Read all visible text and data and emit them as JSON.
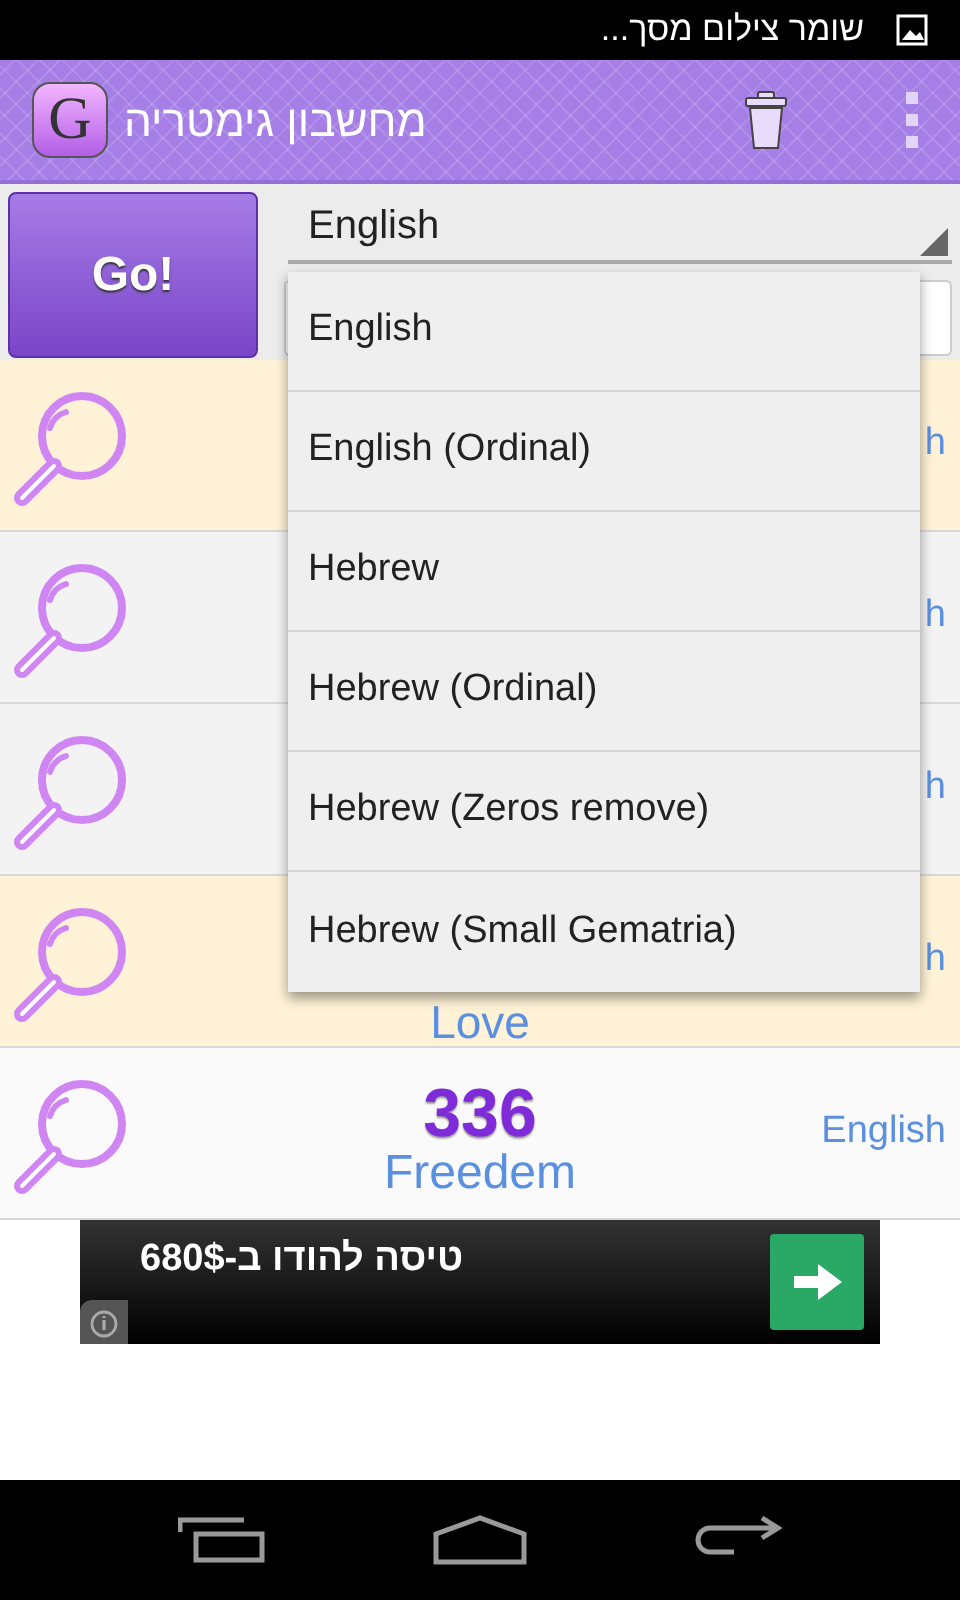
{
  "status_bar": {
    "notification": "שומר צילום מסך..."
  },
  "app_bar": {
    "title": "מחשבון גימטריה",
    "logo_letter": "G"
  },
  "go_button": "Go!",
  "spinner": {
    "value": "English"
  },
  "dropdown": [
    {
      "label": "English",
      "selected": false
    },
    {
      "label": "English (Ordinal)",
      "selected": false
    },
    {
      "label": "Hebrew",
      "selected": false
    },
    {
      "label": "Hebrew (Ordinal)",
      "selected": false
    },
    {
      "label": "Hebrew (Zeros remove)",
      "selected": false
    },
    {
      "label": "Hebrew (Small Gematria)",
      "selected": false
    }
  ],
  "results": [
    {
      "highlighted": true,
      "language": "h"
    },
    {
      "highlighted": false,
      "language": "h"
    },
    {
      "highlighted": false,
      "language": "h"
    },
    {
      "highlighted": true,
      "language": "h",
      "word": "Love"
    },
    {
      "highlighted": false,
      "value": "336",
      "word": "Freedem",
      "language": "English"
    }
  ],
  "ad": {
    "text": "טיסה להודו ב-680$"
  }
}
